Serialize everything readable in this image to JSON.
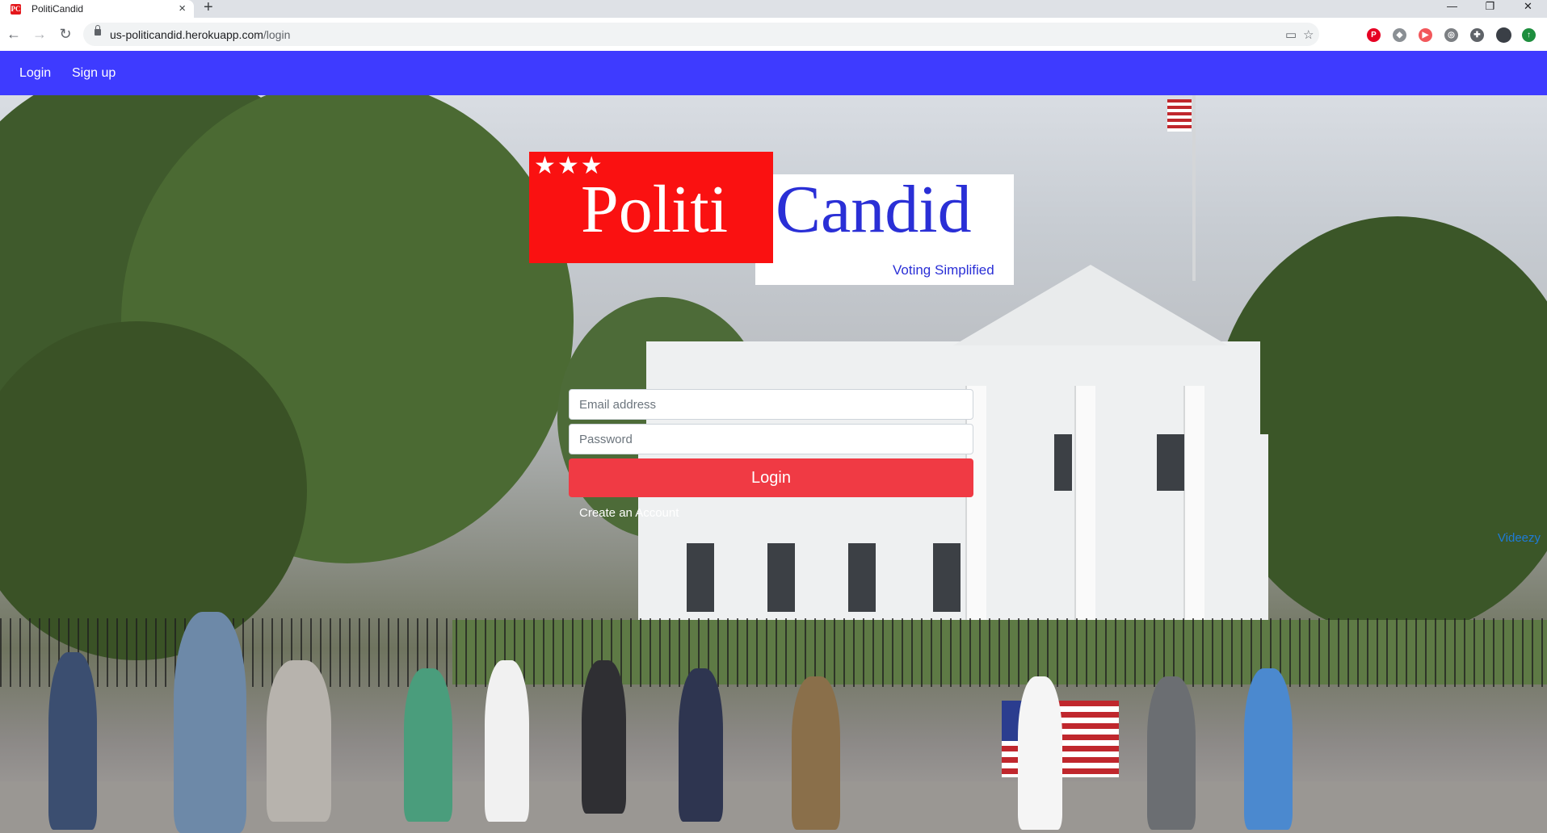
{
  "browser": {
    "tab_title": "PolitiCandid",
    "tab_favicon_text": "PC",
    "url_host": "us-politicandid.herokuapp.com",
    "url_path": "/login"
  },
  "navbar": {
    "links": [
      {
        "label": "Login"
      },
      {
        "label": "Sign up"
      }
    ],
    "color": "#3e3bff"
  },
  "logo": {
    "stars": "★★★",
    "part1": "Politi",
    "part2": "Candid",
    "tagline": "Voting Simplified",
    "red": "#fa1111",
    "blue": "#2a2fd6"
  },
  "form": {
    "email_placeholder": "Email address",
    "password_placeholder": "Password",
    "submit_label": "Login",
    "submit_color": "#f03a44",
    "create_account_label": "Create an Account"
  },
  "credit": "Videezy"
}
